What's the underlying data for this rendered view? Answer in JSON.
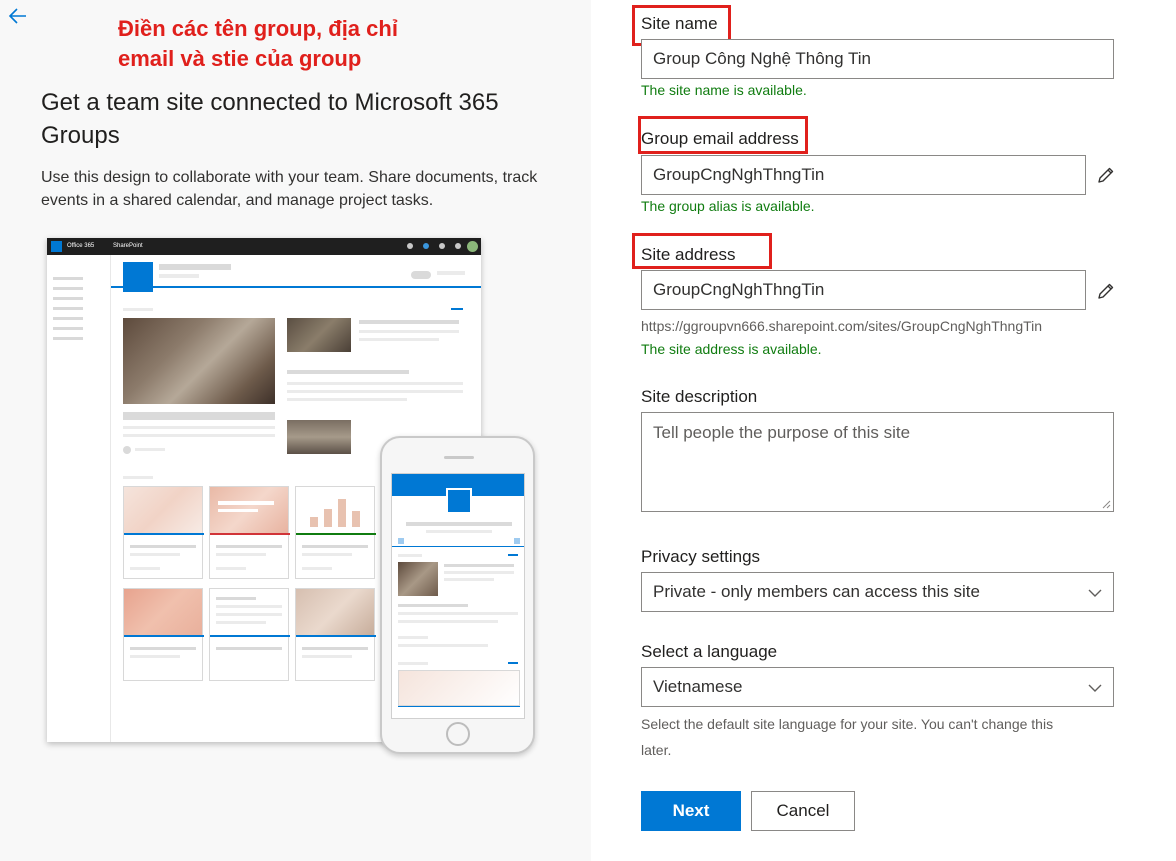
{
  "annotation": {
    "line1": "Điền các tên group, địa chỉ",
    "line2": "email và stie của group",
    "color": "#e0201c"
  },
  "left": {
    "title": "Get a team site connected to Microsoft 365 Groups",
    "description": "Use this design to collaborate with your team. Share documents, track events in a shared calendar, and manage project tasks.",
    "preview": {
      "suite_label": "Office 365",
      "app_label": "SharePoint"
    }
  },
  "form": {
    "site_name": {
      "label": "Site name",
      "value": "Group Công Nghệ Thông Tin",
      "status": "The site name is available."
    },
    "group_email": {
      "label": "Group email address",
      "value": "GroupCngNghThngTin",
      "status": "The group alias is available."
    },
    "site_address": {
      "label": "Site address",
      "value": "GroupCngNghThngTin",
      "url": "https://ggroupvn666.sharepoint.com/sites/GroupCngNghThngTin",
      "status": "The site address is available."
    },
    "site_description": {
      "label": "Site description",
      "placeholder": "Tell people the purpose of this site"
    },
    "privacy": {
      "label": "Privacy settings",
      "selected": "Private - only members can access this site"
    },
    "language": {
      "label": "Select a language",
      "selected": "Vietnamese",
      "hint_line1": "Select the default site language for your site. You can't change this",
      "hint_line2": "later."
    },
    "buttons": {
      "next": "Next",
      "cancel": "Cancel"
    }
  },
  "colors": {
    "accent": "#0078d4",
    "success": "#107c10",
    "highlight": "#e0201c",
    "left_bg": "#f8f8f8"
  },
  "icons": [
    "back-arrow-icon",
    "pencil-icon",
    "chevron-down-icon"
  ]
}
